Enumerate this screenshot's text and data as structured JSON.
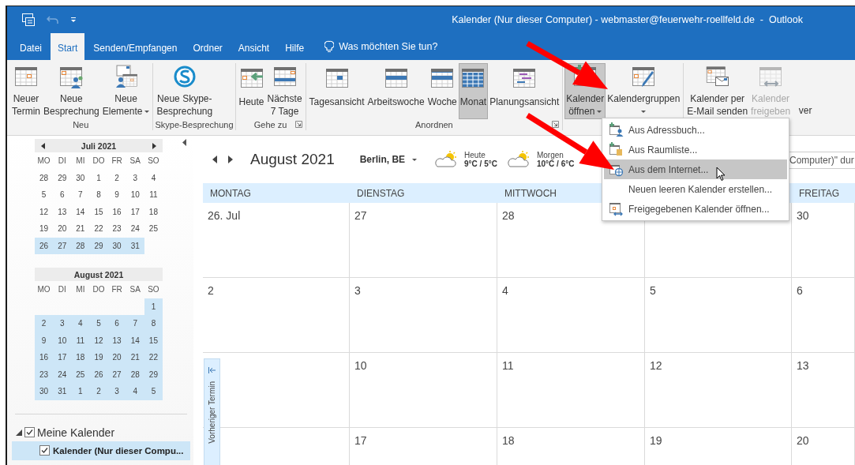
{
  "window": {
    "title": "Kalender (Nur dieser Computer) - webmaster@feuerwehr-roellfeld.de  -  Outlook"
  },
  "quick_access": [
    {
      "kind": "app",
      "disabled": false
    },
    {
      "kind": "undo",
      "disabled": true
    },
    {
      "kind": "customize",
      "disabled": false
    }
  ],
  "tabs": [
    {
      "label": "Datei",
      "selected": false
    },
    {
      "label": "Start",
      "selected": true
    },
    {
      "label": "Senden/Empfangen",
      "selected": false
    },
    {
      "label": "Ordner",
      "selected": false
    },
    {
      "label": "Ansicht",
      "selected": false
    },
    {
      "label": "Hilfe",
      "selected": false
    }
  ],
  "tell_me": {
    "placeholder": "Was möchten Sie tun?"
  },
  "ribbon": {
    "groups": [
      {
        "label": "Neu",
        "buttons": [
          {
            "lines": [
              "Neuer",
              "Termin"
            ],
            "kind": "appointment",
            "dropdown": false,
            "selected": false,
            "disabled": false
          },
          {
            "lines": [
              "Neue",
              "Besprechung"
            ],
            "kind": "meeting",
            "dropdown": false,
            "selected": false,
            "disabled": false
          },
          {
            "lines": [
              "Neue",
              "Elemente"
            ],
            "kind": "items",
            "dropdown": true,
            "selected": false,
            "disabled": false
          }
        ]
      },
      {
        "label": "Skype-Besprechung",
        "buttons": [
          {
            "lines": [
              "Neue Skype-",
              "Besprechung"
            ],
            "kind": "skype",
            "dropdown": false,
            "selected": false,
            "disabled": false
          }
        ]
      },
      {
        "label": "Gehe zu",
        "launcher": true,
        "buttons": [
          {
            "lines": [
              "Heute"
            ],
            "kind": "today",
            "dropdown": false,
            "selected": false,
            "disabled": false
          },
          {
            "lines": [
              "Nächste",
              "7 Tage"
            ],
            "kind": "next7",
            "dropdown": false,
            "selected": false,
            "disabled": false
          }
        ]
      },
      {
        "label": "Anordnen",
        "launcher": true,
        "buttons": [
          {
            "lines": [
              "Tagesansicht"
            ],
            "kind": "day",
            "dropdown": false,
            "selected": false,
            "disabled": false
          },
          {
            "lines": [
              "Arbeitswoche"
            ],
            "kind": "workweek",
            "dropdown": false,
            "selected": false,
            "disabled": false
          },
          {
            "lines": [
              "Woche"
            ],
            "kind": "week",
            "dropdown": false,
            "selected": false,
            "disabled": false
          },
          {
            "lines": [
              "Monat"
            ],
            "kind": "month",
            "dropdown": false,
            "selected": true,
            "disabled": false
          },
          {
            "lines": [
              "Planungsansicht"
            ],
            "kind": "schedule",
            "dropdown": false,
            "selected": false,
            "disabled": false
          }
        ]
      },
      {
        "buttons": [
          {
            "lines": [
              "Kalender",
              "öffnen"
            ],
            "kind": "open",
            "dropdown": true,
            "selected": true,
            "disabled": false
          },
          {
            "lines": [
              "Kalendergruppen"
            ],
            "kind": "groups",
            "dropdown": true,
            "selected": false,
            "disabled": false
          }
        ]
      },
      {
        "buttons": [
          {
            "lines": [
              "Kalender per",
              "E-Mail senden"
            ],
            "kind": "email",
            "dropdown": false,
            "selected": false,
            "disabled": false
          },
          {
            "lines": [
              "Kalender",
              "freigeben"
            ],
            "kind": "share",
            "dropdown": false,
            "selected": false,
            "disabled": true
          },
          {
            "lines": [
              "ver"
            ],
            "kind": "cut",
            "dropdown": false,
            "selected": false,
            "disabled": false
          }
        ]
      }
    ]
  },
  "nav_pane": {
    "months": [
      {
        "title": "Juli 2021",
        "arrows": true,
        "weekdays": [
          "MO",
          "DI",
          "MI",
          "DO",
          "FR",
          "SA",
          "SO"
        ],
        "weeks": [
          [
            {
              "kind": "date",
              "day": "28",
              "highlighted": false
            },
            {
              "kind": "date",
              "day": "29",
              "highlighted": false
            },
            {
              "kind": "date",
              "day": "30",
              "highlighted": false
            },
            {
              "kind": "date",
              "day": "1",
              "highlighted": false
            },
            {
              "kind": "date",
              "day": "2",
              "highlighted": false
            },
            {
              "kind": "date",
              "day": "3",
              "highlighted": false
            },
            {
              "kind": "date",
              "day": "4",
              "highlighted": false
            }
          ],
          [
            {
              "kind": "date",
              "day": "5",
              "highlighted": false
            },
            {
              "kind": "date",
              "day": "6",
              "highlighted": false
            },
            {
              "kind": "date",
              "day": "7",
              "highlighted": false
            },
            {
              "kind": "date",
              "day": "8",
              "highlighted": false
            },
            {
              "kind": "date",
              "day": "9",
              "highlighted": false
            },
            {
              "kind": "date",
              "day": "10",
              "highlighted": false
            },
            {
              "kind": "date",
              "day": "11",
              "highlighted": false
            }
          ],
          [
            {
              "kind": "date",
              "day": "12",
              "highlighted": false
            },
            {
              "kind": "date",
              "day": "13",
              "highlighted": false
            },
            {
              "kind": "date",
              "day": "14",
              "highlighted": false
            },
            {
              "kind": "date",
              "day": "15",
              "highlighted": false
            },
            {
              "kind": "date",
              "day": "16",
              "highlighted": false
            },
            {
              "kind": "date",
              "day": "17",
              "highlighted": false
            },
            {
              "kind": "date",
              "day": "18",
              "highlighted": false
            }
          ],
          [
            {
              "kind": "date",
              "day": "19",
              "highlighted": false
            },
            {
              "kind": "date",
              "day": "20",
              "highlighted": false
            },
            {
              "kind": "date",
              "day": "21",
              "highlighted": false
            },
            {
              "kind": "date",
              "day": "22",
              "highlighted": false
            },
            {
              "kind": "date",
              "day": "23",
              "highlighted": false
            },
            {
              "kind": "date",
              "day": "24",
              "highlighted": false
            },
            {
              "kind": "date",
              "day": "25",
              "highlighted": false
            }
          ],
          [
            {
              "kind": "date",
              "day": "26",
              "highlighted": true
            },
            {
              "kind": "date",
              "day": "27",
              "highlighted": true
            },
            {
              "kind": "date",
              "day": "28",
              "highlighted": true
            },
            {
              "kind": "date",
              "day": "29",
              "highlighted": true
            },
            {
              "kind": "date",
              "day": "30",
              "highlighted": true
            },
            {
              "kind": "date",
              "day": "31",
              "highlighted": true
            },
            {
              "kind": "blank"
            }
          ]
        ]
      },
      {
        "title": "August 2021",
        "weekdays": [
          "MO",
          "DI",
          "MI",
          "DO",
          "FR",
          "SA",
          "SO"
        ],
        "weeks": [
          [
            {
              "kind": "blank"
            },
            {
              "kind": "blank"
            },
            {
              "kind": "blank"
            },
            {
              "kind": "blank"
            },
            {
              "kind": "blank"
            },
            {
              "kind": "blank"
            },
            {
              "kind": "date",
              "day": "1",
              "highlighted": true
            }
          ],
          [
            {
              "kind": "date",
              "day": "2",
              "highlighted": true
            },
            {
              "kind": "date",
              "day": "3",
              "highlighted": true
            },
            {
              "kind": "date",
              "day": "4",
              "highlighted": true
            },
            {
              "kind": "date",
              "day": "5",
              "highlighted": true
            },
            {
              "kind": "date",
              "day": "6",
              "highlighted": true
            },
            {
              "kind": "date",
              "day": "7",
              "highlighted": true
            },
            {
              "kind": "date",
              "day": "8",
              "highlighted": true
            }
          ],
          [
            {
              "kind": "date",
              "day": "9",
              "highlighted": true
            },
            {
              "kind": "date",
              "day": "10",
              "highlighted": true
            },
            {
              "kind": "date",
              "day": "11",
              "highlighted": true
            },
            {
              "kind": "date",
              "day": "12",
              "highlighted": true
            },
            {
              "kind": "date",
              "day": "13",
              "highlighted": true
            },
            {
              "kind": "date",
              "day": "14",
              "highlighted": true
            },
            {
              "kind": "date",
              "day": "15",
              "highlighted": true
            }
          ],
          [
            {
              "kind": "date",
              "day": "16",
              "highlighted": true
            },
            {
              "kind": "date",
              "day": "17",
              "highlighted": true
            },
            {
              "kind": "date",
              "day": "18",
              "highlighted": true
            },
            {
              "kind": "date",
              "day": "19",
              "highlighted": true
            },
            {
              "kind": "date",
              "day": "20",
              "highlighted": true
            },
            {
              "kind": "date",
              "day": "21",
              "highlighted": true
            },
            {
              "kind": "date",
              "day": "22",
              "highlighted": true
            }
          ],
          [
            {
              "kind": "date",
              "day": "23",
              "highlighted": true
            },
            {
              "kind": "date",
              "day": "24",
              "highlighted": true
            },
            {
              "kind": "date",
              "day": "25",
              "highlighted": true
            },
            {
              "kind": "date",
              "day": "26",
              "highlighted": true
            },
            {
              "kind": "date",
              "day": "27",
              "highlighted": true
            },
            {
              "kind": "date",
              "day": "28",
              "highlighted": true
            },
            {
              "kind": "date",
              "day": "29",
              "highlighted": true
            }
          ],
          [
            {
              "kind": "date",
              "day": "30",
              "highlighted": true
            },
            {
              "kind": "date",
              "day": "31",
              "highlighted": true
            },
            {
              "kind": "date",
              "day": "1",
              "highlighted": true
            },
            {
              "kind": "date",
              "day": "2",
              "highlighted": true
            },
            {
              "kind": "date",
              "day": "3",
              "highlighted": true
            },
            {
              "kind": "date",
              "day": "4",
              "highlighted": true
            },
            {
              "kind": "date",
              "day": "5",
              "highlighted": true
            }
          ]
        ]
      }
    ],
    "folders": [
      {
        "label": "Meine Kalender",
        "checked": true,
        "expanded": true,
        "children": [
          {
            "label": "Kalender (Nur dieser Compu...",
            "checked": true,
            "selected": true
          }
        ]
      }
    ]
  },
  "calendar": {
    "title": "August 2021",
    "location": "Berlin, BE",
    "weather": [
      {
        "day": "Heute",
        "temps": "9°C / 5°C"
      },
      {
        "day": "Morgen",
        "temps": "10°C / 6°C"
      }
    ],
    "search": {
      "value": "Computer)\" dur"
    },
    "columns": [
      {
        "kind": "label",
        "label": "MONTAG"
      },
      {
        "kind": "label",
        "label": "DIENSTAG"
      },
      {
        "kind": "label",
        "label": "MITTWOCH"
      },
      {
        "kind": "blank"
      },
      {
        "kind": "label",
        "label": "FREITAG"
      }
    ],
    "weeks": [
      [
        {
          "kind": "date",
          "label": "26. Jul"
        },
        {
          "kind": "date",
          "label": "27"
        },
        {
          "kind": "date",
          "label": "28"
        },
        {
          "kind": "blank"
        },
        {
          "kind": "date",
          "label": "30"
        }
      ],
      [
        {
          "kind": "date",
          "label": "2"
        },
        {
          "kind": "date",
          "label": "3"
        },
        {
          "kind": "date",
          "label": "4"
        },
        {
          "kind": "date",
          "label": "5"
        },
        {
          "kind": "date",
          "label": "6"
        }
      ],
      [
        {
          "kind": "blank"
        },
        {
          "kind": "date",
          "label": "10"
        },
        {
          "kind": "date",
          "label": "11"
        },
        {
          "kind": "date",
          "label": "12"
        },
        {
          "kind": "date",
          "label": "13"
        }
      ],
      [
        {
          "kind": "blank"
        },
        {
          "kind": "date",
          "label": "17"
        },
        {
          "kind": "date",
          "label": "18"
        },
        {
          "kind": "date",
          "label": "19"
        },
        {
          "kind": "date",
          "label": "20"
        }
      ]
    ],
    "side_tab": {
      "label": "Vorheriger Termin"
    }
  },
  "dropdown_menu": {
    "items": [
      {
        "label": "Aus Adressbuch...",
        "kind": "addressbook",
        "selected": false,
        "pointer": false
      },
      {
        "label": "Aus Raumliste...",
        "kind": "room",
        "selected": false,
        "pointer": false
      },
      {
        "label": "Aus dem Internet...",
        "kind": "internet",
        "selected": true,
        "pointer": true
      },
      {
        "label": "Neuen leeren Kalender erstellen...",
        "kind": "plain",
        "selected": false,
        "pointer": false
      },
      {
        "label": "Freigegebenen Kalender öffnen...",
        "kind": "shared",
        "selected": false,
        "pointer": false
      }
    ]
  },
  "annotations": [
    {
      "kind": "arrow"
    },
    {
      "kind": "arrow"
    }
  ]
}
